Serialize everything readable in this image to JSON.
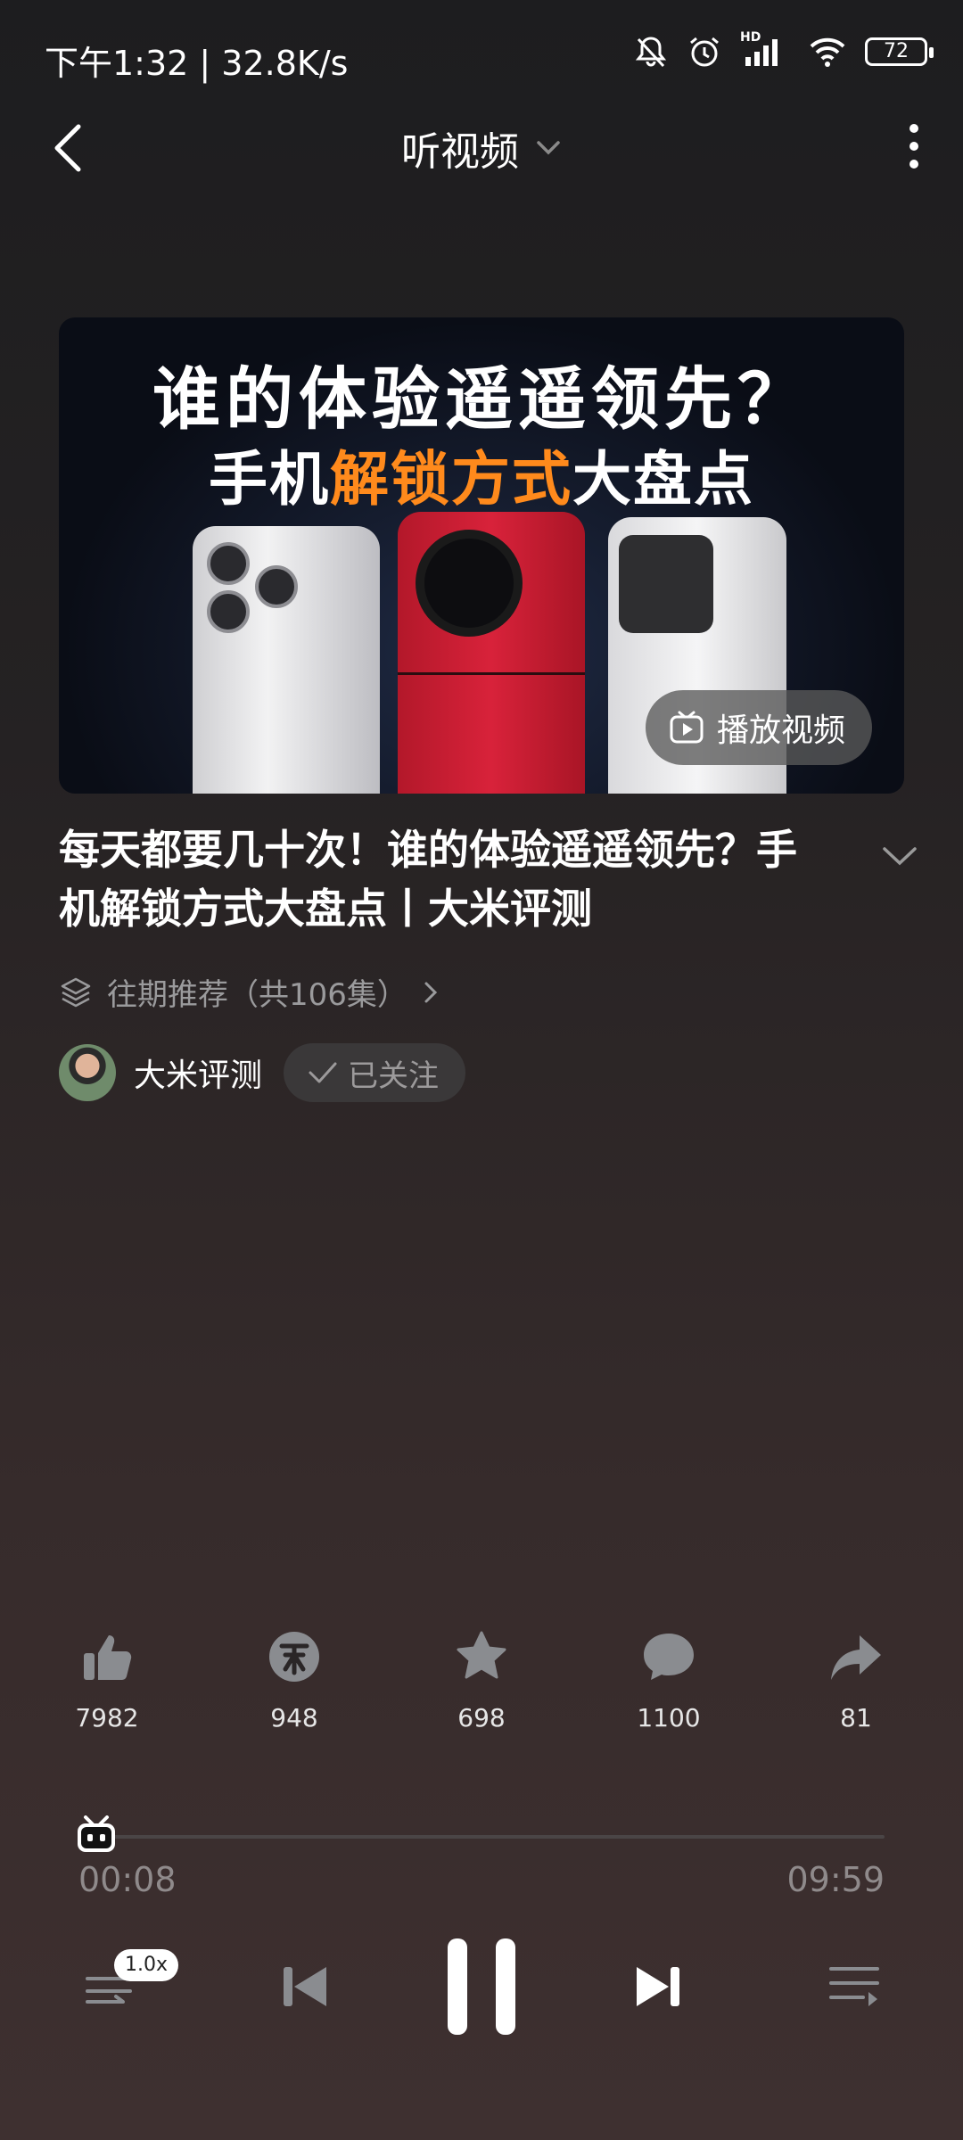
{
  "status_bar": {
    "time_speed": "下午1:32 | 32.8K/s",
    "network": "HD",
    "battery": "72"
  },
  "header": {
    "title": "听视频"
  },
  "cover": {
    "line1": "谁的体验遥遥领先？",
    "line2_part1": "手机",
    "line2_accent": "解锁方式",
    "line2_part2": "大盘点",
    "play_video_label": "播放视频",
    "accent_color": "#ff8a1c"
  },
  "video": {
    "title": "每天都要几十次！谁的体验遥遥领先？手机解锁方式大盘点丨大米评测",
    "series_label": "往期推荐（共106集）"
  },
  "author": {
    "name": "大米评测",
    "follow_label": "已关注"
  },
  "actions": {
    "like_count": "7982",
    "coin_count": "948",
    "favorite_count": "698",
    "comment_count": "1100",
    "share_count": "81"
  },
  "player": {
    "current_time": "00:08",
    "total_time": "09:59",
    "progress": 0.013,
    "speed": "1.0x"
  },
  "colors": {
    "icon_gray": "#8a8c90",
    "icon_white": "#ffffff"
  }
}
